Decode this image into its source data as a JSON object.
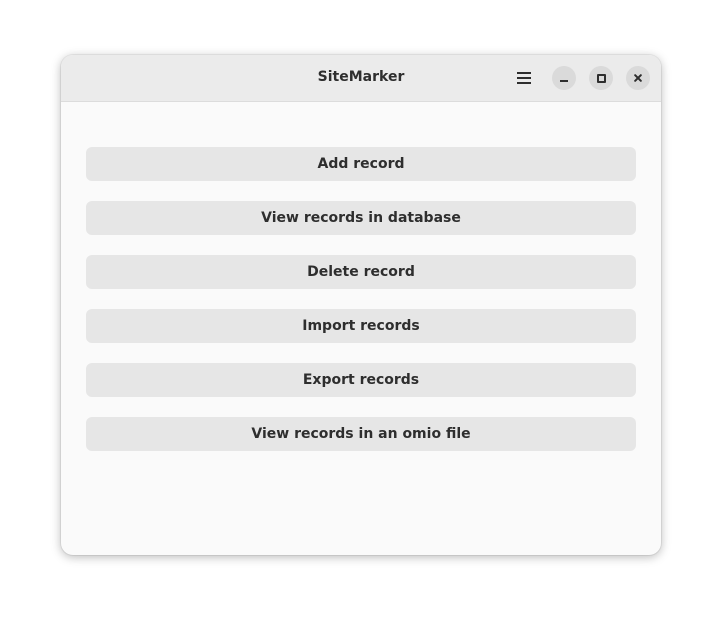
{
  "window": {
    "title": "SiteMarker"
  },
  "headerbar": {
    "menu_icon": "hamburger-menu-icon",
    "minimize_icon": "minimize-icon",
    "maximize_icon": "maximize-icon",
    "close_icon": "close-icon"
  },
  "actions": [
    {
      "label": "Add record"
    },
    {
      "label": "View records in database"
    },
    {
      "label": "Delete record"
    },
    {
      "label": "Import records"
    },
    {
      "label": "Export records"
    },
    {
      "label": "View records in an omio file"
    }
  ],
  "colors": {
    "headerbar_bg": "#ebebeb",
    "window_bg": "#fafafa",
    "button_bg": "#e6e6e6",
    "text": "#2e2e2e"
  }
}
